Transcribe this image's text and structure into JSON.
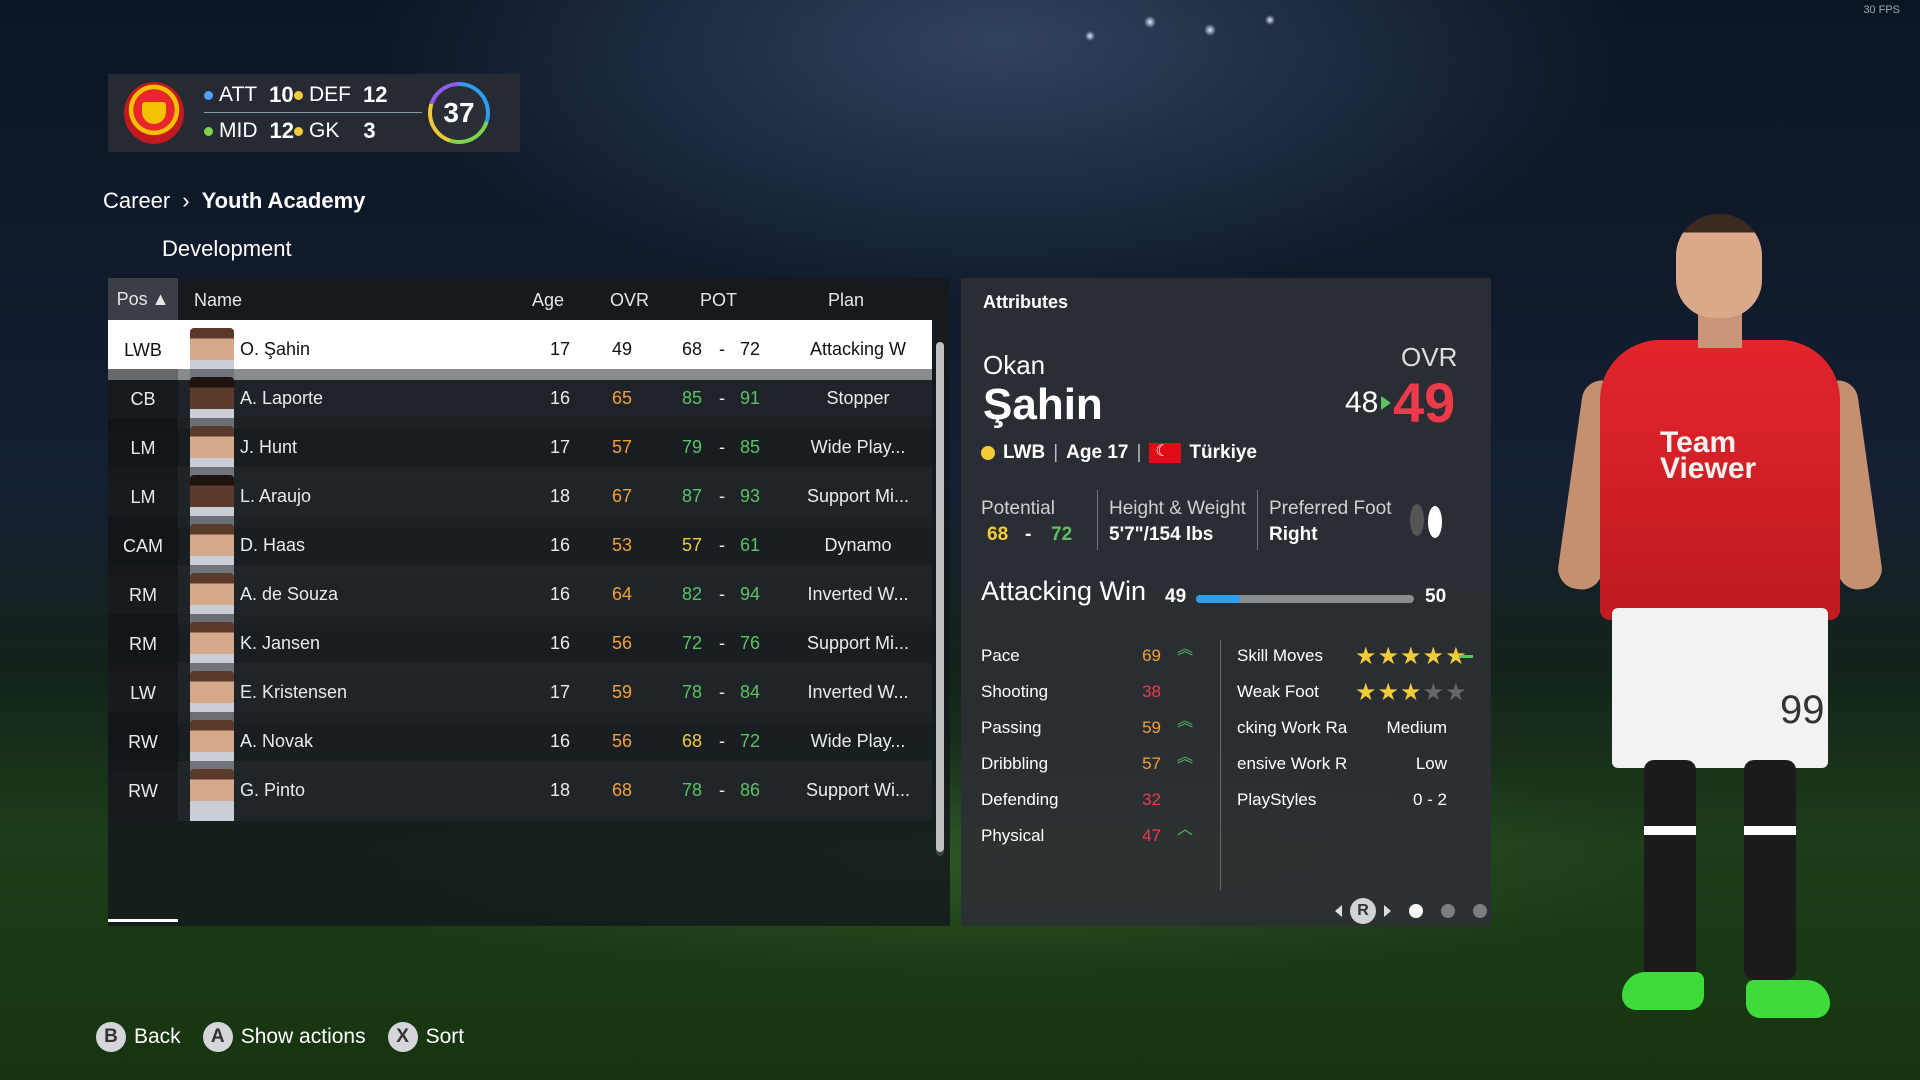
{
  "fps_label": "30 FPS",
  "team": {
    "att_label": "ATT",
    "att_value": "10",
    "def_label": "DEF",
    "def_value": "12",
    "mid_label": "MID",
    "mid_value": "12",
    "gk_label": "GK",
    "gk_value": "3",
    "total": "37",
    "colors": {
      "att": "#4aa3ff",
      "def": "#f2cc38",
      "mid": "#7fd24a",
      "gk": "#f2cc38"
    }
  },
  "breadcrumb": {
    "root": "Career",
    "current": "Youth Academy"
  },
  "subtitle": "Development",
  "table": {
    "headers": {
      "pos": "Pos",
      "name": "Name",
      "age": "Age",
      "ovr": "OVR",
      "pot": "POT",
      "plan": "Plan"
    },
    "rows": [
      {
        "pos": "LWB",
        "name": "O. Şahin",
        "age": "17",
        "ovr": "49",
        "pot_lo": "68",
        "pot_hi": "72",
        "plan": "Attacking W"
      },
      {
        "pos": "CB",
        "name": "A. Laporte",
        "age": "16",
        "ovr": "65",
        "pot_lo": "85",
        "pot_hi": "91",
        "plan": "Stopper"
      },
      {
        "pos": "LM",
        "name": "J. Hunt",
        "age": "17",
        "ovr": "57",
        "pot_lo": "79",
        "pot_hi": "85",
        "plan": "Wide Play..."
      },
      {
        "pos": "LM",
        "name": "L. Araujo",
        "age": "18",
        "ovr": "67",
        "pot_lo": "87",
        "pot_hi": "93",
        "plan": "Support Mi..."
      },
      {
        "pos": "CAM",
        "name": "D. Haas",
        "age": "16",
        "ovr": "53",
        "pot_lo": "57",
        "pot_hi": "61",
        "plan": "Dynamo"
      },
      {
        "pos": "RM",
        "name": "A. de Souza",
        "age": "16",
        "ovr": "64",
        "pot_lo": "82",
        "pot_hi": "94",
        "plan": "Inverted W..."
      },
      {
        "pos": "RM",
        "name": "K. Jansen",
        "age": "16",
        "ovr": "56",
        "pot_lo": "72",
        "pot_hi": "76",
        "plan": "Support Mi..."
      },
      {
        "pos": "LW",
        "name": "E. Kristensen",
        "age": "17",
        "ovr": "59",
        "pot_lo": "78",
        "pot_hi": "84",
        "plan": "Inverted W..."
      },
      {
        "pos": "RW",
        "name": "A. Novak",
        "age": "16",
        "ovr": "56",
        "pot_lo": "68",
        "pot_hi": "72",
        "plan": "Wide Play..."
      },
      {
        "pos": "RW",
        "name": "G. Pinto",
        "age": "18",
        "ovr": "68",
        "pot_lo": "78",
        "pot_hi": "86",
        "plan": "Support Wi..."
      }
    ]
  },
  "attributes": {
    "title": "Attributes",
    "first_name": "Okan",
    "last_name": "Şahin",
    "ovr_label": "OVR",
    "ovr_old": "48",
    "ovr_new": "49",
    "position": "LWB",
    "age_text": "Age 17",
    "nation": "Türkiye",
    "potential_label": "Potential",
    "potential_lo": "68",
    "potential_dash": "-",
    "potential_hi": "72",
    "hw_label": "Height & Weight",
    "hw_value": "5'7\"/154 lbs",
    "foot_label": "Preferred Foot",
    "foot_value": "Right",
    "plan_name": "Attacking Win",
    "plan_lo": "49",
    "plan_hi": "50",
    "plan_progress": 0.2,
    "stats": [
      {
        "name": "Pace",
        "value": "69",
        "color": "#f3a03a",
        "arrow": "double-up"
      },
      {
        "name": "Shooting",
        "value": "38",
        "color": "#ec3a4a",
        "arrow": ""
      },
      {
        "name": "Passing",
        "value": "59",
        "color": "#f3a03a",
        "arrow": "double-up"
      },
      {
        "name": "Dribbling",
        "value": "57",
        "color": "#f3a03a",
        "arrow": "double-up"
      },
      {
        "name": "Defending",
        "value": "32",
        "color": "#ec3a4a",
        "arrow": ""
      },
      {
        "name": "Physical",
        "value": "47",
        "color": "#ec3a4a",
        "arrow": "up"
      }
    ],
    "skills": [
      {
        "name": "Skill Moves",
        "stars": 5
      },
      {
        "name": "Weak Foot",
        "stars": 3
      },
      {
        "name": "cking Work Ra",
        "value": "Medium"
      },
      {
        "name": "ensive Work Ra",
        "value": "Low"
      },
      {
        "name": "PlayStyles",
        "value": "0 - 2"
      }
    ],
    "pager_button": "R"
  },
  "player_model": {
    "sponsor": "Team Viewer",
    "shorts_number": "99"
  },
  "footer": [
    {
      "button": "B",
      "label": "Back"
    },
    {
      "button": "A",
      "label": "Show actions"
    },
    {
      "button": "X",
      "label": "Sort"
    }
  ]
}
